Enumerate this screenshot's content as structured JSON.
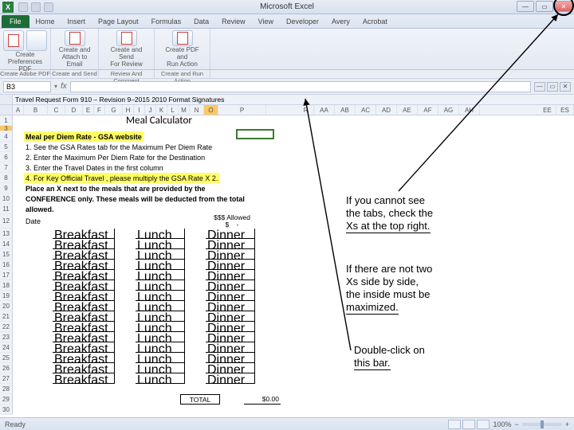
{
  "titlebar": {
    "app": "Microsoft Excel",
    "excel_glyph": "X"
  },
  "tabs": {
    "file": "File",
    "items": [
      "Home",
      "Insert",
      "Page Layout",
      "Formulas",
      "Data",
      "Review",
      "View",
      "Developer",
      "Avery",
      "Acrobat"
    ]
  },
  "ribbon": {
    "groups": [
      {
        "label": "Create\nPreferences\nPDF",
        "sub": "Create Adobe PDF"
      },
      {
        "label": "Create and\nAttach to Email",
        "sub": "Create and Send"
      },
      {
        "label": "Create and Send\nFor Review",
        "sub": "Review And Comment"
      },
      {
        "label": "Create PDF and\nRun Action",
        "sub": "Create and Run Action"
      }
    ]
  },
  "namebox": "B3",
  "workbook_tab": "Travel Request Form 910 – Revision 9–2015 2010 Format Signatures",
  "columns_left": [
    "A",
    "B",
    "C",
    "D",
    "E",
    "F",
    "G",
    "H",
    "I",
    "J",
    "K",
    "L",
    "M",
    "N",
    "O",
    "P"
  ],
  "columns_right": [
    "R",
    "AA",
    "AB",
    "AC",
    "AD",
    "AE",
    "AF",
    "AG",
    "AH",
    "EE",
    "ES"
  ],
  "sheet": {
    "title": "Meal Calculator",
    "r4": "Meal per Diem Rate  - GSA website",
    "r5": "1. See the GSA Rates tab for the Maximum Per Diem Rate",
    "r6": "2. Enter the Maximum Per Diem Rate for the Destination",
    "r7": "3. Enter the Travel Dates in the first column",
    "r8": "4. For Key Official Travel , please multiply the GSA Rate X 2.",
    "conf1": "Place an X next to the meals that are provided by the",
    "conf2": "CONFERENCE only.  These meals will be deducted from the total",
    "conf3": "allowed.",
    "date_hdr": "Date",
    "allowed_hdr": "$$$ Allowed",
    "dollar": "$",
    "dash": "-",
    "bf": "Breakfast",
    "ln": "Lunch",
    "dn": "Dinner",
    "total": "TOTAL",
    "total_val": "$0.00"
  },
  "row_numbers": [
    "1",
    "3",
    "4",
    "5",
    "6",
    "7",
    "8",
    "9",
    "10",
    "11",
    "12",
    "13",
    "14",
    "15",
    "16",
    "17",
    "18",
    "19",
    "20",
    "21",
    "22",
    "23",
    "24",
    "25",
    "26",
    "27",
    "28",
    "29",
    "30"
  ],
  "annotations": {
    "n1a": "If you cannot see",
    "n1b": "the tabs, check the",
    "n1c": "Xs at the top right.",
    "n2a": "If there are not two",
    "n2b": "Xs side by side,",
    "n2c": "the inside must be",
    "n2d": "maximized.",
    "n3a": "Double-click on",
    "n3b": "this bar."
  },
  "status": {
    "ready": "Ready",
    "zoom": "100%"
  }
}
